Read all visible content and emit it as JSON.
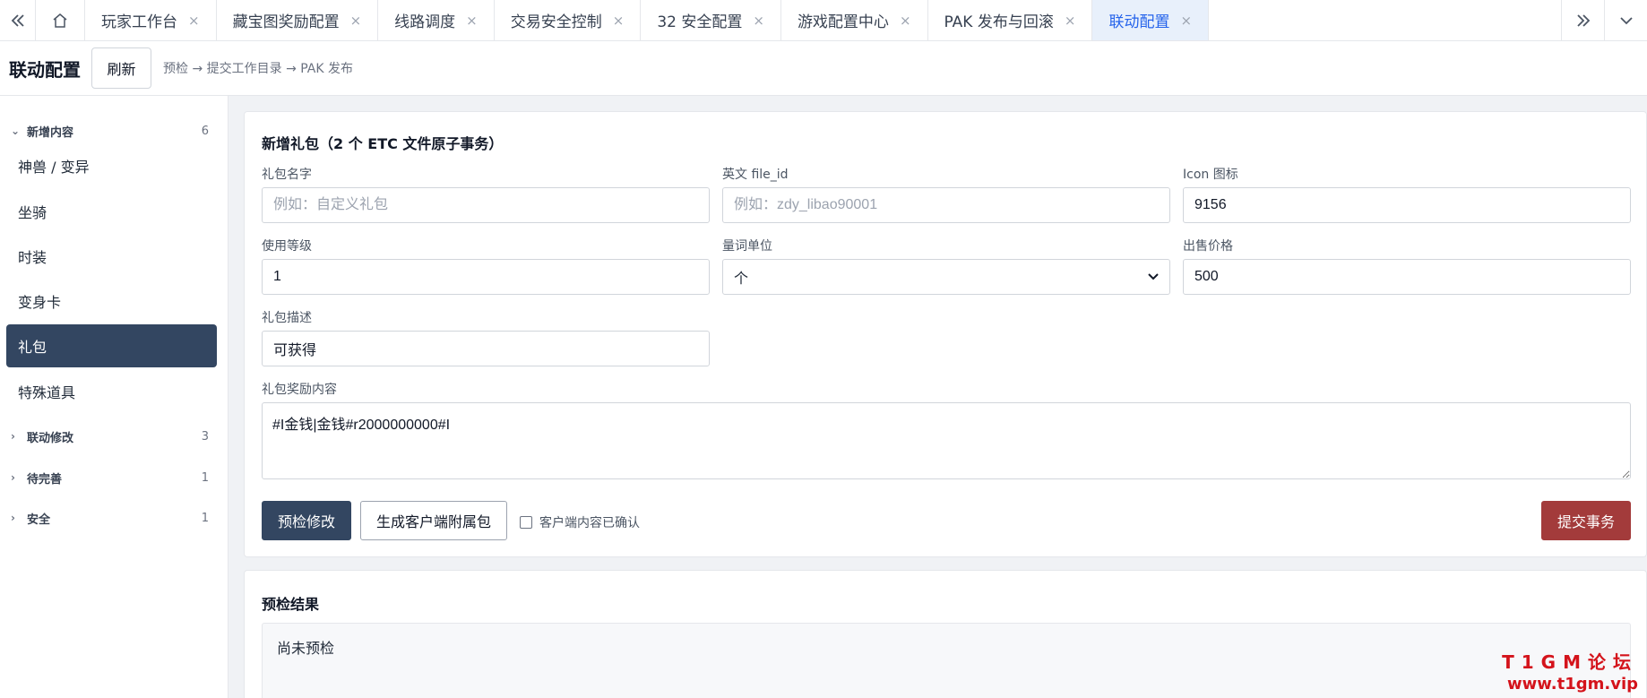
{
  "tabs": {
    "items": [
      {
        "label": "玩家工作台"
      },
      {
        "label": "藏宝图奖励配置"
      },
      {
        "label": "线路调度"
      },
      {
        "label": "交易安全控制"
      },
      {
        "label": "32 安全配置"
      },
      {
        "label": "游戏配置中心"
      },
      {
        "label": "PAK 发布与回滚"
      },
      {
        "label": "联动配置",
        "active": true
      }
    ],
    "close_symbol": "×"
  },
  "header": {
    "title": "联动配置",
    "refresh_label": "刷新",
    "breadcrumb": "预检 → 提交工作目录 → PAK 发布"
  },
  "sidebar": {
    "groups": [
      {
        "label": "新增内容",
        "count": "6",
        "expanded": true
      },
      {
        "label": "联动修改",
        "count": "3"
      },
      {
        "label": "待完善",
        "count": "1"
      },
      {
        "label": "安全",
        "count": "1"
      }
    ],
    "items": [
      {
        "label": "神兽 / 变异"
      },
      {
        "label": "坐骑"
      },
      {
        "label": "时装"
      },
      {
        "label": "变身卡"
      },
      {
        "label": "礼包",
        "active": true
      },
      {
        "label": "特殊道具"
      }
    ]
  },
  "form": {
    "title": "新增礼包（2 个 ETC 文件原子事务）",
    "name": {
      "label": "礼包名字",
      "placeholder": "例如：自定义礼包",
      "value": ""
    },
    "file_id": {
      "label": "英文 file_id",
      "placeholder": "例如：zdy_libao90001",
      "value": ""
    },
    "icon": {
      "label": "Icon 图标",
      "value": "9156"
    },
    "level": {
      "label": "使用等级",
      "value": "1"
    },
    "unit": {
      "label": "量词单位",
      "value": "个"
    },
    "price": {
      "label": "出售价格",
      "value": "500"
    },
    "desc": {
      "label": "礼包描述",
      "value": "可获得"
    },
    "reward": {
      "label": "礼包奖励内容",
      "value": "#I金钱|金钱#r2000000000#I"
    },
    "precheck_label": "预检修改",
    "gen_client_label": "生成客户端附属包",
    "confirm_label": "客户端内容已确认",
    "confirm_checked": false,
    "submit_label": "提交事务"
  },
  "result": {
    "title": "预检结果",
    "text": "尚未预检"
  },
  "watermark": {
    "line1": "T1GM论坛",
    "line2": "www.t1gm.vip"
  },
  "colors": {
    "primary": "#334661",
    "danger": "#a33b3b",
    "active_tab": "#2563eb",
    "watermark": "#d4131b"
  }
}
